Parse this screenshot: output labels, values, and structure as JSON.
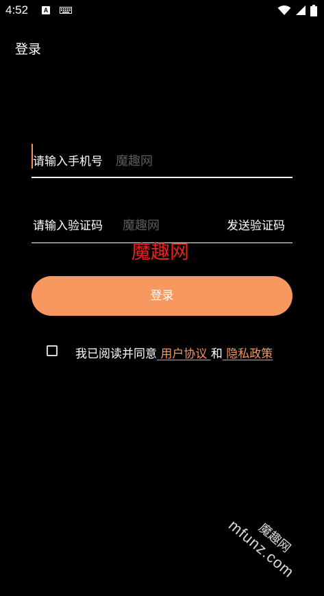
{
  "status_bar": {
    "time": "4:52",
    "notification_icons": [
      "a-notification-icon",
      "keyboard-icon"
    ],
    "system_icons": [
      "wifi-icon",
      "signal-icon",
      "battery-icon"
    ],
    "a_glyph": "A"
  },
  "header": {
    "title": "登录"
  },
  "phone_field": {
    "placeholder": "请输入手机号",
    "watermark": "魔趣网"
  },
  "code_field": {
    "placeholder": "请输入验证码",
    "watermark": "魔趣网",
    "send_code_label": "发送验证码"
  },
  "overlay_watermark": "魔趣网",
  "login_button_label": "登录",
  "agreement": {
    "prefix": "我已阅读并同意",
    "user_agreement": " 用户协议 ",
    "connector": "和",
    "privacy_policy": " 隐私政策"
  },
  "corner_watermark": {
    "cn": "魔趣网",
    "en": "mfunz.com"
  },
  "colors": {
    "background": "#000000",
    "accent": "#f6985f",
    "link": "#f6955a",
    "watermark_red": "#e8211c"
  }
}
